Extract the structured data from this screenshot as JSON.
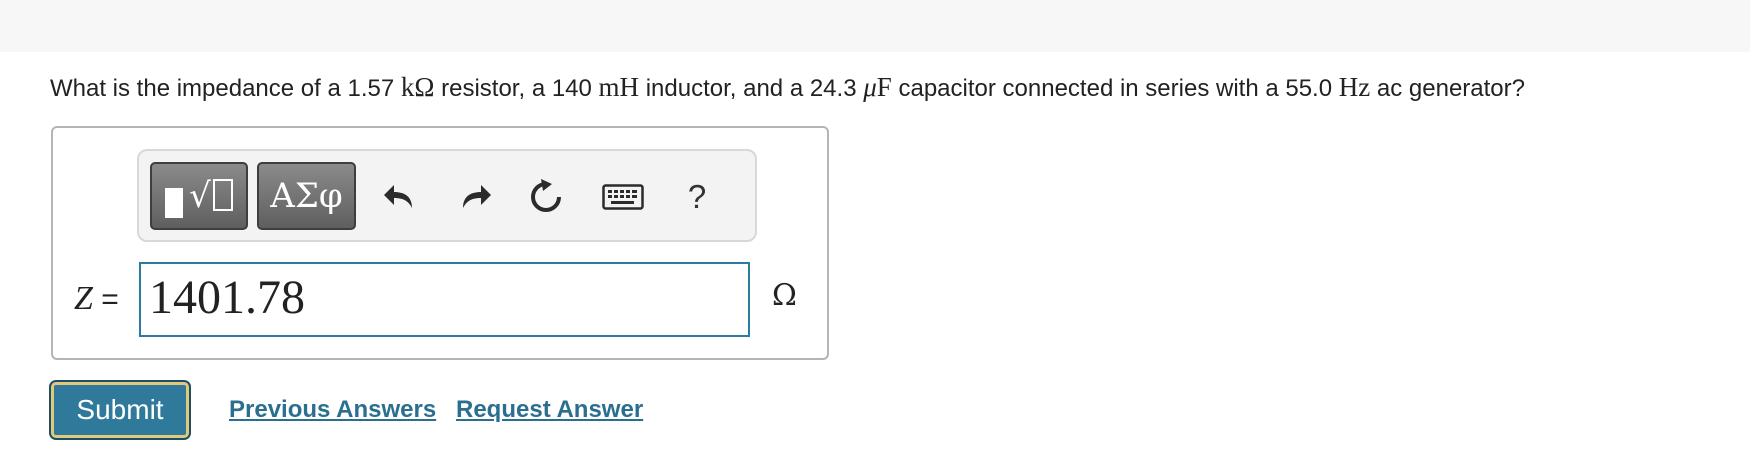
{
  "question": {
    "t1": "What is the impedance of a 1.57 ",
    "u1": "kΩ",
    "t2": " resistor, a 140 ",
    "u2": "mH",
    "t3": " inductor, and a 24.3 ",
    "u3_mu": "μ",
    "u3_f": "F",
    "t4": " capacitor connected in series with a 55.0 ",
    "u4": "Hz",
    "t5": " ac generator?"
  },
  "toolbar": {
    "templates_icon": "template-radical-icon",
    "symbols_label": "ΑΣφ",
    "undo_icon": "undo-icon",
    "redo_icon": "redo-icon",
    "reset_icon": "reset-icon",
    "keyboard_icon": "keyboard-icon",
    "help_label": "?"
  },
  "answer": {
    "variable": "Z",
    "equals": "=",
    "value": "1401.78",
    "unit": "Ω"
  },
  "actions": {
    "submit_label": "Submit",
    "previous_answers_label": "Previous Answers",
    "request_answer_label": "Request Answer"
  },
  "colors": {
    "accent": "#2f7a9b",
    "link": "#2a6f8f",
    "input_border": "#2b7da0"
  }
}
